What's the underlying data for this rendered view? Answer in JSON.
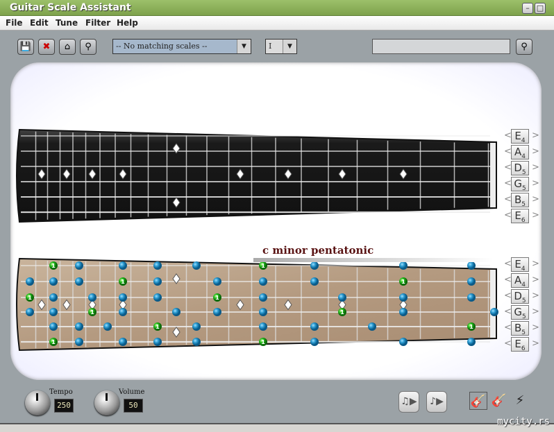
{
  "window": {
    "title": "Guitar Scale Assistant",
    "minimize": "–",
    "maximize": "□",
    "close": "✕"
  },
  "menu": [
    "File",
    "Edit",
    "Tune",
    "Filter",
    "Help"
  ],
  "toolbar": {
    "save_icon": "💾",
    "delete_icon": "✖",
    "open_icon": "⌂",
    "find_icon": "⚲",
    "scale_select": "-- No matching scales --",
    "position_select": "I",
    "search_value": "",
    "search_icon": "⚲",
    "dropdown_arrow": "▼"
  },
  "tuning": [
    {
      "note": "E",
      "oct": "4"
    },
    {
      "note": "A",
      "oct": "4"
    },
    {
      "note": "D",
      "oct": "5"
    },
    {
      "note": "G",
      "oct": "5"
    },
    {
      "note": "B",
      "oct": "5"
    },
    {
      "note": "E",
      "oct": "6"
    }
  ],
  "arrows": {
    "left": "<",
    "right": ">"
  },
  "scale_name": "c minor pentatonic",
  "marker_frets": [
    3,
    5,
    7,
    9,
    12,
    15,
    17,
    19,
    21
  ],
  "notes": [
    {
      "s": 0,
      "f": 20,
      "root": true
    },
    {
      "s": 0,
      "f": 18
    },
    {
      "s": 0,
      "f": 15
    },
    {
      "s": 0,
      "f": 13
    },
    {
      "s": 0,
      "f": 11
    },
    {
      "s": 0,
      "f": 8,
      "root": true
    },
    {
      "s": 0,
      "f": 6
    },
    {
      "s": 0,
      "f": 3
    },
    {
      "s": 0,
      "f": 1
    },
    {
      "s": 1,
      "f": 22
    },
    {
      "s": 1,
      "f": 20
    },
    {
      "s": 1,
      "f": 18
    },
    {
      "s": 1,
      "f": 15,
      "root": true
    },
    {
      "s": 1,
      "f": 13
    },
    {
      "s": 1,
      "f": 10
    },
    {
      "s": 1,
      "f": 8
    },
    {
      "s": 1,
      "f": 6
    },
    {
      "s": 1,
      "f": 3,
      "root": true
    },
    {
      "s": 1,
      "f": 1
    },
    {
      "s": 2,
      "f": 22,
      "root": true
    },
    {
      "s": 2,
      "f": 20
    },
    {
      "s": 2,
      "f": 17
    },
    {
      "s": 2,
      "f": 15
    },
    {
      "s": 2,
      "f": 13
    },
    {
      "s": 2,
      "f": 10,
      "root": true
    },
    {
      "s": 2,
      "f": 8
    },
    {
      "s": 2,
      "f": 5
    },
    {
      "s": 2,
      "f": 3
    },
    {
      "s": 2,
      "f": 1
    },
    {
      "s": 3,
      "f": 22
    },
    {
      "s": 3,
      "f": 20
    },
    {
      "s": 3,
      "f": 17,
      "root": true
    },
    {
      "s": 3,
      "f": 15
    },
    {
      "s": 3,
      "f": 12
    },
    {
      "s": 3,
      "f": 10
    },
    {
      "s": 3,
      "f": 8
    },
    {
      "s": 3,
      "f": 5,
      "root": true
    },
    {
      "s": 3,
      "f": 3
    },
    {
      "s": 3,
      "f": 0
    },
    {
      "s": 4,
      "f": 20
    },
    {
      "s": 4,
      "f": 18
    },
    {
      "s": 4,
      "f": 16
    },
    {
      "s": 4,
      "f": 13,
      "root": true
    },
    {
      "s": 4,
      "f": 11
    },
    {
      "s": 4,
      "f": 8
    },
    {
      "s": 4,
      "f": 6
    },
    {
      "s": 4,
      "f": 4
    },
    {
      "s": 4,
      "f": 1,
      "root": true
    },
    {
      "s": 5,
      "f": 20,
      "root": true
    },
    {
      "s": 5,
      "f": 18
    },
    {
      "s": 5,
      "f": 15
    },
    {
      "s": 5,
      "f": 13
    },
    {
      "s": 5,
      "f": 11
    },
    {
      "s": 5,
      "f": 8,
      "root": true
    },
    {
      "s": 5,
      "f": 6
    },
    {
      "s": 5,
      "f": 3
    },
    {
      "s": 5,
      "f": 1
    }
  ],
  "root_label": "1",
  "controls": {
    "tempo_label": "Tempo",
    "tempo_value": "250",
    "volume_label": "Volume",
    "volume_value": "50",
    "play_scale_icon": "♫▶",
    "play_chord_icon": "♪▶",
    "guitar_acoustic": "🎸",
    "guitar_electric": "🎸",
    "guitar_flyingv": "⚡"
  },
  "watermark": "mycity.rs"
}
